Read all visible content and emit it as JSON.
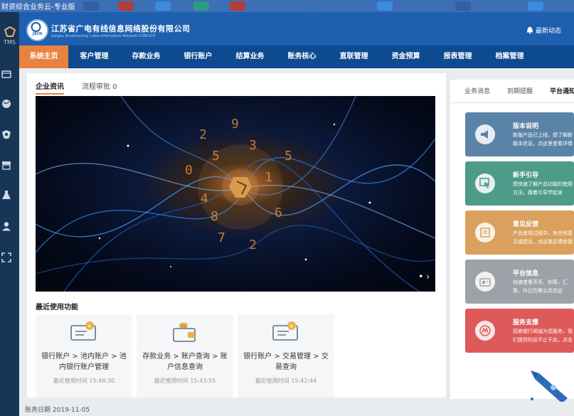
{
  "window": {
    "title": "财资综合业务云-专业版"
  },
  "taskbar": {
    "apps": [
      {
        "color": "#2f5fa0"
      },
      {
        "color": "#c0392b"
      },
      {
        "color": "#3a8ee6"
      },
      {
        "color": "#27a37a"
      },
      {
        "color": "#c0392b"
      },
      {
        "color": "#3b6fb5"
      },
      {
        "color": "#3a8ee6"
      },
      {
        "color": "#2f5fa0"
      },
      {
        "color": "#3a8ee6"
      }
    ]
  },
  "sidebar": {
    "logo": "TMS",
    "icons": [
      "wallet-icon",
      "globe-icon",
      "shield-icon",
      "store-icon",
      "flask-icon",
      "user-icon",
      "expand-icon"
    ]
  },
  "header": {
    "company_cn": "江苏省广电有线信息网络股份有限公司",
    "company_en": "Jiangsu Broadcasting Cable Information Network CORP.LTD",
    "logo_text": "JSCN",
    "notice": "最新动态"
  },
  "nav": {
    "items": [
      "系统主页",
      "客户管理",
      "存款业务",
      "银行账户",
      "结算业务",
      "账务核心",
      "直联管理",
      "资金预算",
      "报表管理",
      "档案管理"
    ],
    "active_index": 0
  },
  "main": {
    "tabs": [
      "企业资讯",
      "流程审批 0"
    ],
    "banner": {
      "dots": "• ›"
    },
    "recent": {
      "title": "最近使用功能",
      "cards": [
        {
          "path": "银行账户 > 池内账户 > 池内银行账户管理",
          "time": "最近使用时间 15:48:30"
        },
        {
          "path": "存款业务 > 账户查询 > 账户信息查询",
          "time": "最近使用时间 15:43:55"
        },
        {
          "path": "银行账户 > 交易管理 > 交易查询",
          "time": "最近使用时间 15:42:44"
        }
      ]
    }
  },
  "right": {
    "tabs": [
      "业务消息",
      "到期提醒",
      "平台通知"
    ],
    "active_tab": 2,
    "cards": [
      {
        "title": "版本说明",
        "desc": "新版产品已上线，想了解新版本信息，点这里查看详情",
        "color": "#5b83a7",
        "icon": "megaphone-icon"
      },
      {
        "title": "新手引导",
        "desc": "想快速了解产品功能的使用方法，跟着引导学起来",
        "color": "#4f9b8a",
        "icon": "cursor-icon"
      },
      {
        "title": "意见反馈",
        "desc": "产品使用过程中，有任何意见或建议，点这里反馈给我们",
        "color": "#d9a15d",
        "icon": "document-icon"
      },
      {
        "title": "平台信息",
        "desc": "快速查看币币、利率、汇率、作日历等公共信息",
        "color": "#9ea2a8",
        "icon": "radio-icon"
      },
      {
        "title": "服务支撑",
        "desc": "招商银行竭诚为您服务，我们提供的远不止于此，点击了解",
        "color": "#de5a5a",
        "icon": "cmb-icon"
      }
    ]
  },
  "footer": {
    "date": "账务日期 2019-11-05"
  }
}
